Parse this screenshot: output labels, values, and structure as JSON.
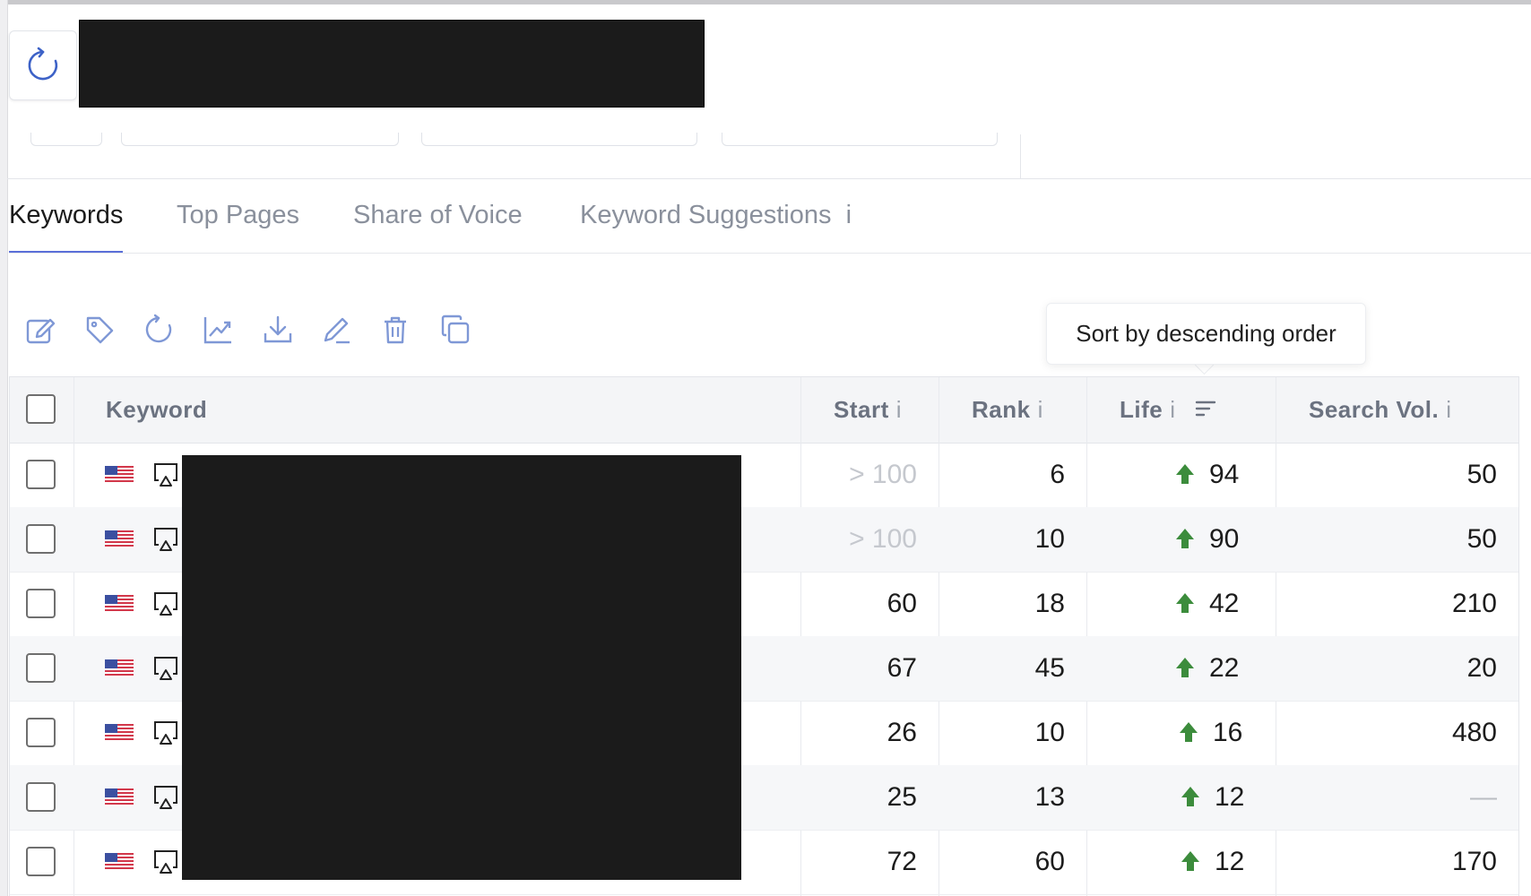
{
  "tabs": [
    "Keywords",
    "Top Pages",
    "Share of Voice",
    "Keyword Suggestions"
  ],
  "tab_info_glyph": "i",
  "toolbar": [
    "edit-icon",
    "tag-icon",
    "refresh-icon",
    "chart-trend-icon",
    "download-icon",
    "pen-icon",
    "trash-icon",
    "copy-icon"
  ],
  "tooltip": "Sort by descending order",
  "table": {
    "headers": {
      "keyword": "Keyword",
      "start": "Start",
      "rank": "Rank",
      "life": "Life",
      "search_vol": "Search Vol.",
      "info": "i"
    },
    "rows": [
      {
        "start": "> 100",
        "rank": "6",
        "life": "94",
        "search_vol": "50"
      },
      {
        "start": "> 100",
        "rank": "10",
        "life": "90",
        "search_vol": "50"
      },
      {
        "start": "60",
        "rank": "18",
        "life": "42",
        "search_vol": "210"
      },
      {
        "start": "67",
        "rank": "45",
        "life": "22",
        "search_vol": "20"
      },
      {
        "start": "26",
        "rank": "10",
        "life": "16",
        "search_vol": "480"
      },
      {
        "start": "25",
        "rank": "13",
        "life": "12",
        "search_vol": "—"
      },
      {
        "start": "72",
        "rank": "60",
        "life": "12",
        "search_vol": "170"
      }
    ]
  },
  "colors": {
    "accent": "#5b6fd8",
    "up_arrow": "#3c8c3c",
    "icon_blue": "#7f98d6"
  }
}
